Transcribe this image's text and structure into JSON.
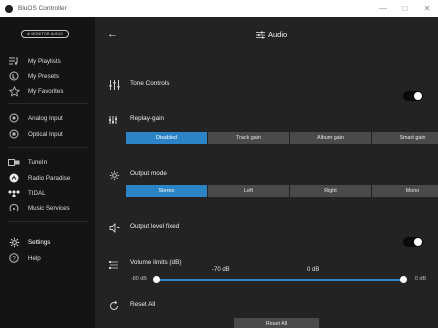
{
  "window": {
    "title": "BluOS Controller",
    "minimize": "—",
    "maximize": "□",
    "close": "✕"
  },
  "sidebar": {
    "brand": "⊕ MONITOR AUDIO",
    "items": [
      {
        "label": "My Playlists",
        "icon": "playlist-icon"
      },
      {
        "label": "My Presets",
        "icon": "presets-icon"
      },
      {
        "label": "My Favorites",
        "icon": "star-icon"
      },
      {
        "label": "Analog Input",
        "icon": "analog-input-icon"
      },
      {
        "label": "Optical Input",
        "icon": "optical-input-icon"
      },
      {
        "label": "TuneIn",
        "icon": "tunein-icon"
      },
      {
        "label": "Radio Paradise",
        "icon": "radio-paradise-icon"
      },
      {
        "label": "TIDAL",
        "icon": "tidal-icon"
      },
      {
        "label": "Music Services",
        "icon": "music-services-icon"
      },
      {
        "label": "Settings",
        "icon": "gear-icon"
      },
      {
        "label": "Help",
        "icon": "help-icon"
      }
    ]
  },
  "header": {
    "title": "Audio",
    "back": "←"
  },
  "tone_controls": {
    "label": "Tone Controls",
    "enabled": true
  },
  "replay_gain": {
    "label": "Replay-gain",
    "options": [
      "Disabled",
      "Track gain",
      "Album gain",
      "Smart gain"
    ],
    "selected": "Disabled"
  },
  "output_mode": {
    "label": "Output mode",
    "options": [
      "Stereo",
      "Left",
      "Right",
      "Mono"
    ],
    "selected": "Stereo"
  },
  "output_level_fixed": {
    "label": "Output level fixed",
    "enabled": true
  },
  "volume_limits": {
    "label": "Volume limits (dB)",
    "min_label": "-80 dB",
    "max_label": "0 dB",
    "low_value_label": "-70 dB",
    "high_value_label": "0 dB",
    "low_value": -70,
    "high_value": 0
  },
  "reset": {
    "label": "Reset All",
    "button": "Reset All"
  },
  "colors": {
    "accent": "#2c84c6",
    "sidebar_bg": "#141414",
    "main_bg": "#232323"
  }
}
